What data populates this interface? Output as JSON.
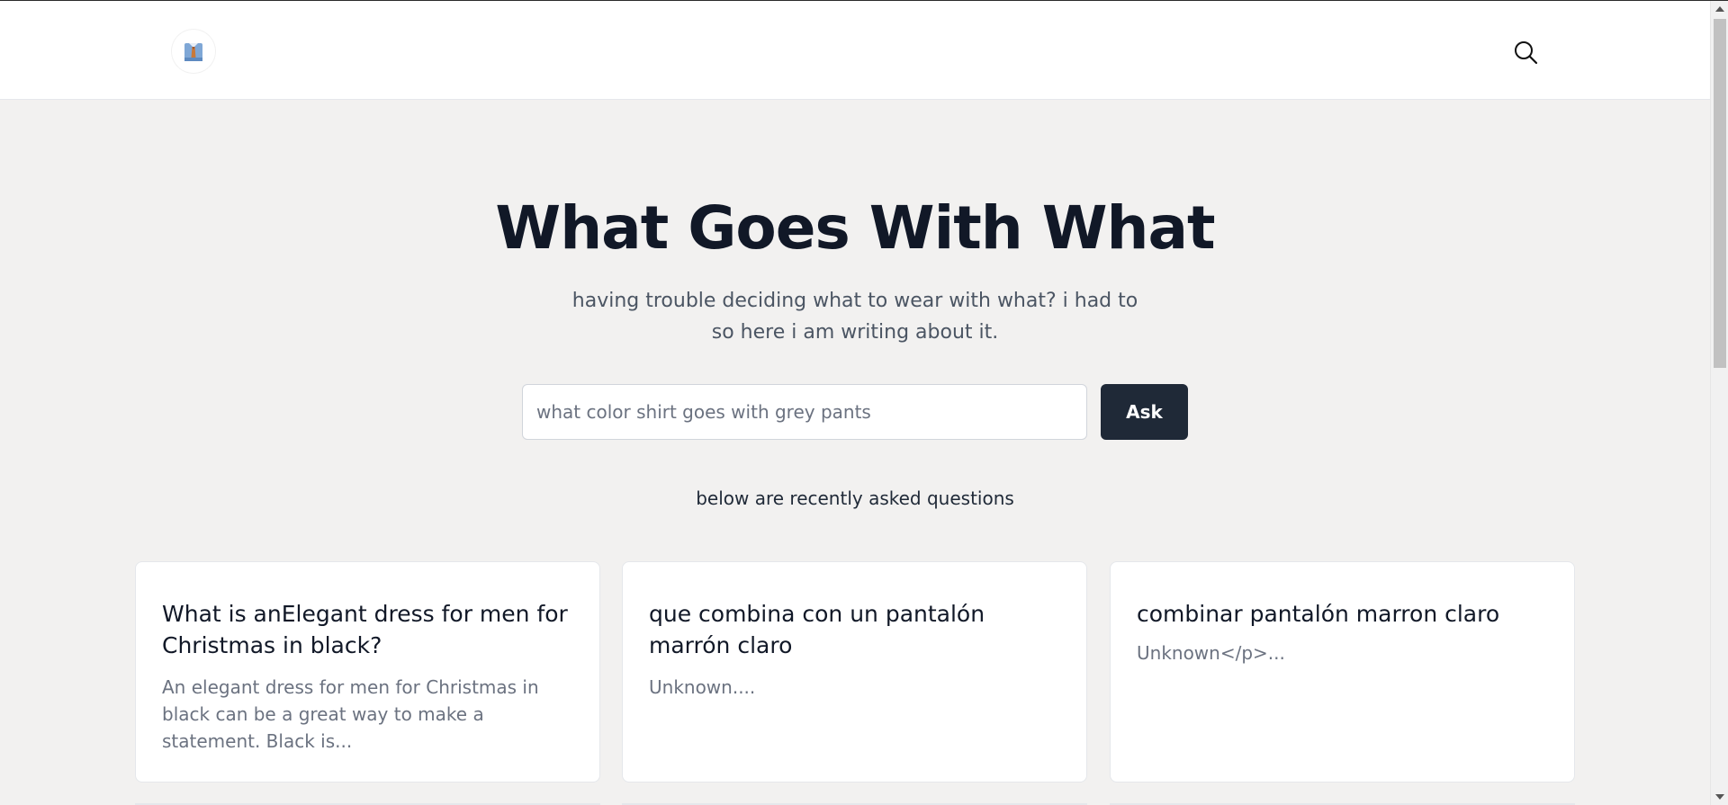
{
  "header": {
    "logo_icon": "necktie-shirt-icon",
    "search_icon": "search-icon"
  },
  "hero": {
    "title": "What Goes With What",
    "subtitle": "having trouble deciding what to wear with what? i had to so here i am writing about it."
  },
  "ask": {
    "input_value": "",
    "placeholder": "what color shirt goes with grey pants",
    "button_label": "Ask"
  },
  "recent": {
    "label": "below are recently asked questions",
    "cards": [
      {
        "title": "What is anElegant dress for men for Christmas in black?",
        "excerpt": "An elegant dress for men for Christmas in black can be a great way to make a statement. Black is..."
      },
      {
        "title": "que combina con un pantalón marrón claro",
        "excerpt": "Unknown...."
      },
      {
        "title": "combinar pantalón marron claro",
        "excerpt": "Unknown</p>..."
      }
    ]
  },
  "colors": {
    "page_bg": "#f2f1f0",
    "header_bg": "#ffffff",
    "button_bg": "#1f2937",
    "title_text": "#111827",
    "muted_text": "#6b7280"
  }
}
